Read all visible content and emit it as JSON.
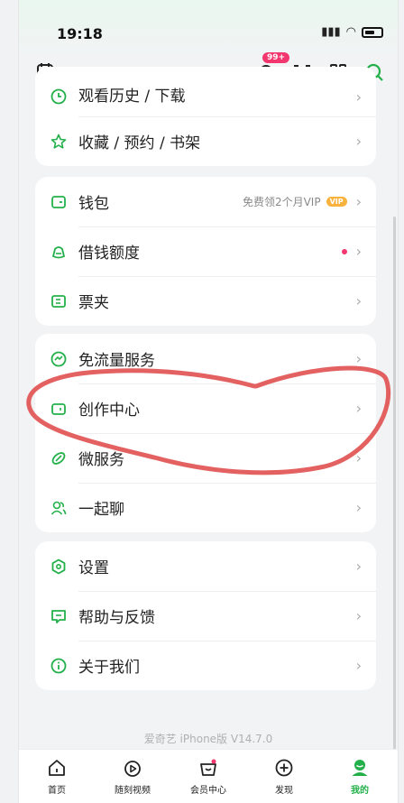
{
  "status": {
    "time": "19:18"
  },
  "header": {
    "badge": "99+"
  },
  "sections": [
    {
      "items": [
        {
          "label": "观看历史 / 下载",
          "icon": "clock-icon"
        },
        {
          "label": "收藏 / 预约 / 书架",
          "icon": "star-icon"
        }
      ]
    },
    {
      "items": [
        {
          "label": "钱包",
          "icon": "wallet-icon",
          "extra": "免费领2个月VIP",
          "extra_badge": "VIP"
        },
        {
          "label": "借钱额度",
          "icon": "money-bag-icon",
          "dot": true
        },
        {
          "label": "票夹",
          "icon": "ticket-icon"
        }
      ]
    },
    {
      "items": [
        {
          "label": "免流量服务",
          "icon": "data-free-icon"
        },
        {
          "label": "创作中心",
          "icon": "camera-icon"
        },
        {
          "label": "微服务",
          "icon": "services-icon"
        },
        {
          "label": "一起聊",
          "icon": "chat-people-icon"
        }
      ]
    },
    {
      "items": [
        {
          "label": "设置",
          "icon": "settings-icon"
        },
        {
          "label": "帮助与反馈",
          "icon": "feedback-icon"
        },
        {
          "label": "关于我们",
          "icon": "info-icon"
        }
      ]
    }
  ],
  "footer": {
    "version": "爱奇艺 iPhone版 V14.7.0"
  },
  "tabbar": {
    "items": [
      {
        "label": "首页",
        "icon": "home-icon"
      },
      {
        "label": "随刻视频",
        "icon": "video-icon"
      },
      {
        "label": "会员中心",
        "icon": "member-icon"
      },
      {
        "label": "发现",
        "icon": "discover-icon"
      },
      {
        "label": "我的",
        "icon": "profile-icon",
        "active": true
      }
    ]
  },
  "colors": {
    "accent": "#23b04a",
    "badge": "#f3366e",
    "annotation": "#e05050"
  }
}
